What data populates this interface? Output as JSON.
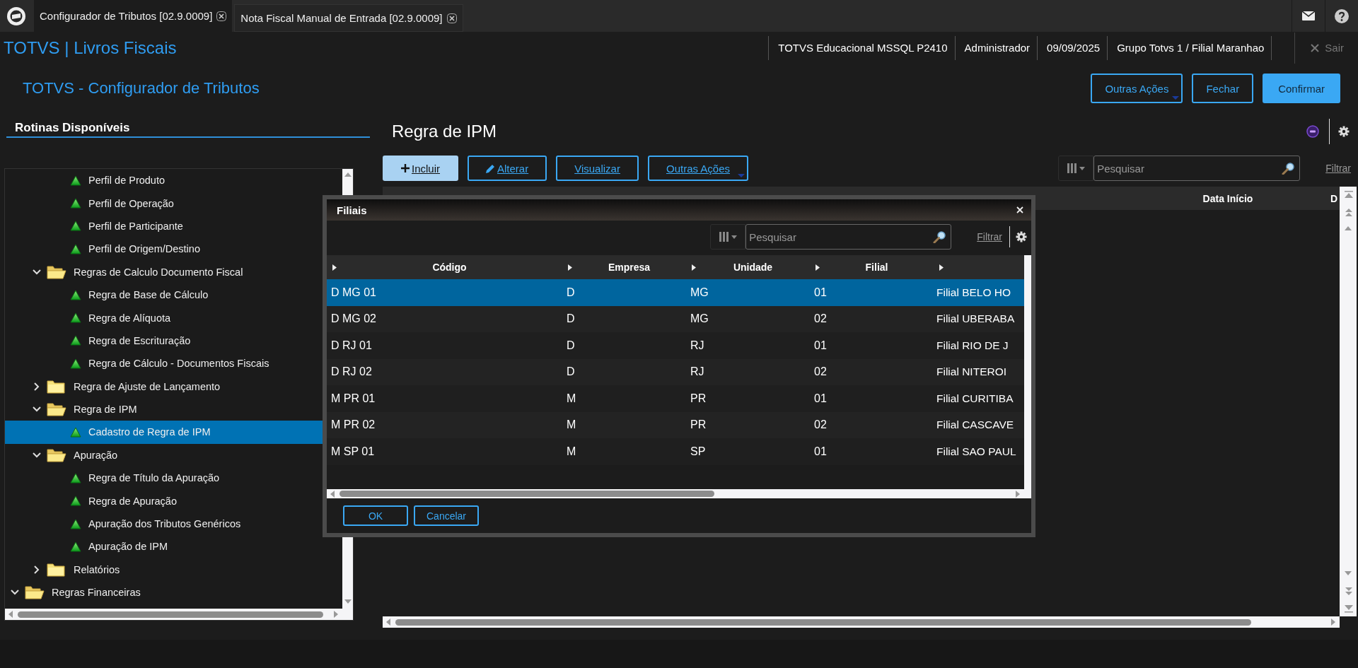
{
  "app_tabs": [
    {
      "label": "Configurador de Tributos [02.9.0009]",
      "selected": true
    },
    {
      "label": "Nota Fiscal Manual de Entrada [02.9.0009]",
      "selected": false
    }
  ],
  "header": {
    "title": "TOTVS | Livros Fiscais",
    "info": [
      "TOTVS Educacional MSSQL P2410",
      "Administrador",
      "09/09/2025",
      "Grupo Totvs 1 / Filial Maranhao"
    ],
    "logout": {
      "label": "Sair",
      "disabled": true
    }
  },
  "page": {
    "title": "TOTVS - Configurador de Tributos",
    "actions": [
      {
        "label": "Outras Ações",
        "kind": "menu"
      },
      {
        "label": "Fechar",
        "kind": "outline"
      },
      {
        "label": "Confirmar",
        "kind": "primary"
      }
    ]
  },
  "sidebar": {
    "title": "Rotinas Disponíveis",
    "tree": [
      {
        "kind": "folder",
        "children": [
          {
            "kind": "folder",
            "children": [
              {
                "kind": "leaf",
                "label": "Perfil de Produto",
                "selected": false
              },
              {
                "kind": "leaf",
                "label": "Perfil de Operação",
                "selected": false
              },
              {
                "kind": "leaf",
                "label": "Perfil de Participante",
                "selected": false
              },
              {
                "kind": "leaf",
                "label": "Perfil de Origem/Destino",
                "selected": false
              }
            ]
          },
          {
            "kind": "folder",
            "label": "Regras de Calculo Documento Fiscal",
            "expanded": true,
            "selected": false,
            "children": [
              {
                "kind": "leaf",
                "label": "Regra de Base de Cálculo",
                "selected": false
              },
              {
                "kind": "leaf",
                "label": "Regra de Alíquota",
                "selected": false
              },
              {
                "kind": "leaf",
                "label": "Regra de Escrituração",
                "selected": false
              },
              {
                "kind": "leaf",
                "label": "Regra de Cálculo - Documentos Fiscais",
                "selected": false
              }
            ]
          },
          {
            "kind": "folder",
            "label": "Regra de Ajuste de Lançamento",
            "expanded": false,
            "selected": false
          },
          {
            "kind": "folder",
            "label": "Regra de IPM",
            "expanded": true,
            "selected": false,
            "children": [
              {
                "kind": "leaf",
                "label": "Cadastro de Regra de IPM",
                "selected": true
              }
            ]
          },
          {
            "kind": "folder",
            "label": "Apuração",
            "expanded": true,
            "selected": false,
            "children": [
              {
                "kind": "leaf",
                "label": "Regra de Título da Apuração",
                "selected": false
              },
              {
                "kind": "leaf",
                "label": "Regra de Apuração",
                "selected": false
              },
              {
                "kind": "leaf",
                "label": "Apuração dos Tributos Genéricos",
                "selected": false
              },
              {
                "kind": "leaf",
                "label": "Apuração de IPM",
                "selected": false
              }
            ]
          },
          {
            "kind": "folder",
            "label": "Relatórios",
            "expanded": false,
            "selected": false
          }
        ]
      },
      {
        "kind": "folder",
        "label": "Regras Financeiras",
        "expanded": true,
        "selected": false
      }
    ]
  },
  "main": {
    "title": "Regra de IPM",
    "toolbar": [
      {
        "label": "Incluir",
        "kind": "add",
        "focused": true
      },
      {
        "label": "Alterar",
        "kind": "edit",
        "focused": false
      },
      {
        "label": "Visualizar",
        "kind": "plain",
        "focused": false
      },
      {
        "label": "Outras Ações",
        "kind": "menu",
        "focused": false
      }
    ],
    "search": {
      "placeholder": "Pesquisar"
    },
    "filter_link": "Filtrar",
    "table": {
      "columns": [
        "Data Início",
        "D"
      ]
    }
  },
  "dialog": {
    "title": "Filiais",
    "search": {
      "placeholder": "Pesquisar"
    },
    "filter_link": "Filtrar",
    "table": {
      "columns": [
        "Código",
        "Empresa",
        "Unidade",
        "Filial"
      ],
      "rows": [
        {
          "cells": [
            "D MG 01",
            "D",
            "MG",
            "01",
            "Filial BELO HO"
          ],
          "selected": true
        },
        {
          "cells": [
            "D MG 02",
            "D",
            "MG",
            "02",
            "Filial UBERABA"
          ],
          "selected": false
        },
        {
          "cells": [
            "D RJ 01",
            "D",
            "RJ",
            "01",
            "Filial RIO DE J"
          ],
          "selected": false
        },
        {
          "cells": [
            "D RJ 02",
            "D",
            "RJ",
            "02",
            "Filial NITEROI"
          ],
          "selected": false
        },
        {
          "cells": [
            "M PR 01",
            "M",
            "PR",
            "01",
            "Filial CURITIBA"
          ],
          "selected": false
        },
        {
          "cells": [
            "M PR 02",
            "M",
            "PR",
            "02",
            "Filial CASCAVE"
          ],
          "selected": false
        },
        {
          "cells": [
            "M SP 01",
            "M",
            "SP",
            "01",
            "Filial SAO PAUL"
          ],
          "selected": false
        }
      ]
    },
    "buttons": [
      "OK",
      "Cancelar"
    ]
  }
}
